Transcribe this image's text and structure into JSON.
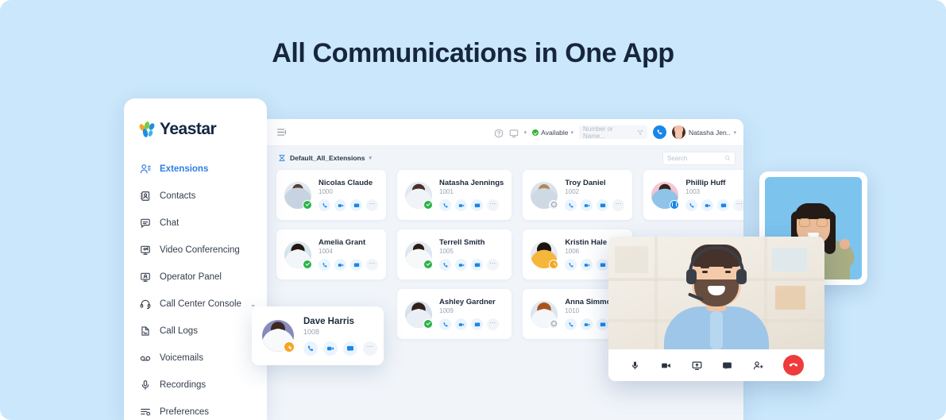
{
  "headline": "All Communications in One App",
  "brand": {
    "name": "Yeastar"
  },
  "sidebar": {
    "items": [
      {
        "label": "Extensions",
        "icon": "extensions-icon",
        "active": true,
        "chevron": ""
      },
      {
        "label": "Contacts",
        "icon": "contacts-icon",
        "active": false,
        "chevron": ""
      },
      {
        "label": "Chat",
        "icon": "chat-icon",
        "active": false,
        "chevron": ""
      },
      {
        "label": "Video Conferencing",
        "icon": "video-conferencing-icon",
        "active": false,
        "chevron": ""
      },
      {
        "label": "Operator Panel",
        "icon": "operator-panel-icon",
        "active": false,
        "chevron": ""
      },
      {
        "label": "Call Center Console",
        "icon": "headset-icon",
        "active": false,
        "chevron": "⌄"
      },
      {
        "label": "Call Logs",
        "icon": "call-logs-icon",
        "active": false,
        "chevron": ""
      },
      {
        "label": "Voicemails",
        "icon": "voicemail-icon",
        "active": false,
        "chevron": ""
      },
      {
        "label": "Recordings",
        "icon": "recordings-icon",
        "active": false,
        "chevron": ""
      },
      {
        "label": "Preferences",
        "icon": "preferences-icon",
        "active": false,
        "chevron": ""
      }
    ]
  },
  "app": {
    "topbar": {
      "menu_icon": "hamburger-icon",
      "help_icon": "help-circle-icon",
      "device_icon": "monitor-icon",
      "status_label": "Available",
      "search_placeholder": "Number or Name...",
      "call_icon": "phone-icon",
      "user_name": "Natasha Jen.."
    },
    "subbar": {
      "group_label": "Default_All_Extensions",
      "search_placeholder": "Search"
    },
    "action_buttons": [
      {
        "name": "call-button",
        "icon": "phone-icon"
      },
      {
        "name": "video-button",
        "icon": "video-icon"
      },
      {
        "name": "chat-button",
        "icon": "chat-icon"
      },
      {
        "name": "more-button",
        "icon": "ellipsis-icon",
        "glyph": "⋯"
      }
    ],
    "contacts": [
      {
        "name": "Nicolas Claude",
        "ext": "1000",
        "status": "online",
        "avatar": "male-brown-hair"
      },
      {
        "name": "Natasha Jennings",
        "ext": "1001",
        "status": "online",
        "avatar": "female-glasses"
      },
      {
        "name": "Troy Daniel",
        "ext": "1002",
        "status": "offline",
        "avatar": "male-blonde"
      },
      {
        "name": "Phillip Huff",
        "ext": "1003",
        "status": "dnd",
        "avatar": "male-pink-bg"
      },
      {
        "name": "Amelia Grant",
        "ext": "1004",
        "status": "online",
        "avatar": "female-dark-hair"
      },
      {
        "name": "Terrell Smith",
        "ext": "1005",
        "status": "online",
        "avatar": "male-sunglasses"
      },
      {
        "name": "Kristin Hale",
        "ext": "1006",
        "status": "away",
        "avatar": "female-curly"
      },
      {
        "name": "",
        "ext": "",
        "status": "none",
        "avatar": ""
      },
      {
        "name": "",
        "ext": "",
        "status": "none",
        "avatar": ""
      },
      {
        "name": "Ashley Gardner",
        "ext": "1009",
        "status": "online",
        "avatar": "female-headset"
      },
      {
        "name": "Anna Simmons",
        "ext": "1010",
        "status": "offline",
        "avatar": "female-red-hair"
      },
      {
        "name": "",
        "ext": "",
        "status": "none",
        "avatar": ""
      }
    ]
  },
  "floating_card": {
    "name": "Dave Harris",
    "ext": "1008",
    "status": "away",
    "actions": [
      {
        "name": "call-button",
        "icon": "phone-icon"
      },
      {
        "name": "video-button",
        "icon": "video-icon"
      },
      {
        "name": "chat-button",
        "icon": "chat-icon"
      },
      {
        "name": "more-button",
        "icon": "ellipsis-icon",
        "glyph": "⋯"
      }
    ]
  },
  "video_call": {
    "participant": "man-with-headset",
    "thumbnail_participant": "woman-with-glasses",
    "controls": [
      {
        "name": "mute-mic-button",
        "icon": "microphone-icon"
      },
      {
        "name": "toggle-camera-button",
        "icon": "video-camera-icon"
      },
      {
        "name": "share-screen-button",
        "icon": "screen-share-icon"
      },
      {
        "name": "chat-button",
        "icon": "chat-icon"
      },
      {
        "name": "participants-button",
        "icon": "people-icon"
      },
      {
        "name": "end-call-button",
        "icon": "hang-up-icon"
      }
    ]
  },
  "colors": {
    "page_background": "#cae7fb",
    "headline": "#17263c",
    "accent_blue": "#1a86e8",
    "active_nav": "#2f7fe0",
    "status_online": "#2bb34b",
    "status_away": "#f5a623",
    "end_call_red": "#ef3b3b",
    "app_background": "#f1f5fa"
  }
}
